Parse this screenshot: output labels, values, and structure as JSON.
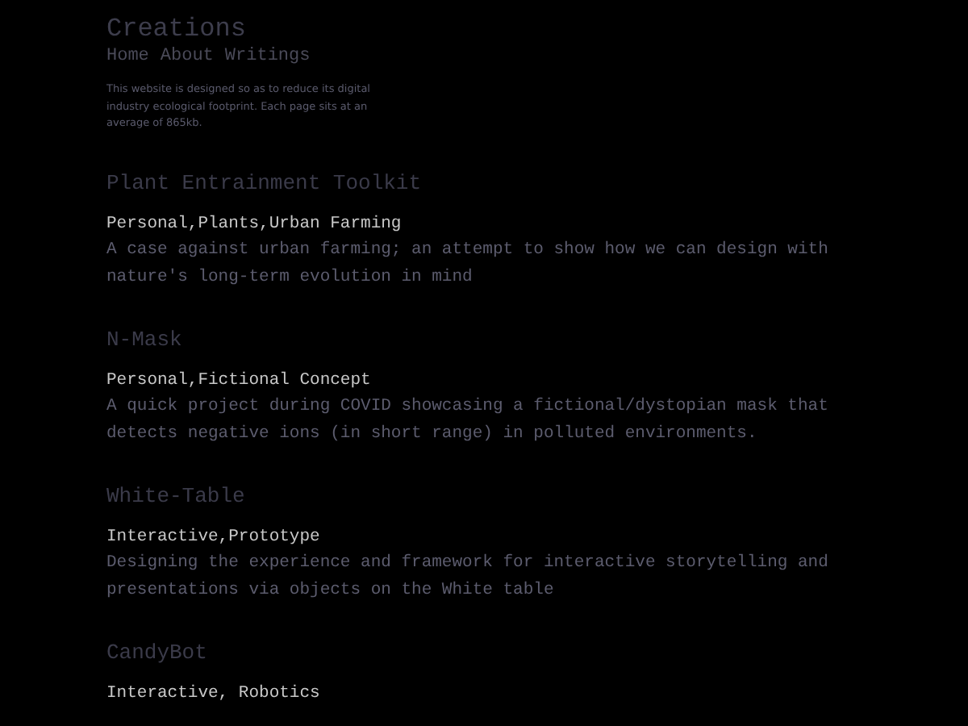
{
  "site_title": "Creations",
  "nav": [
    {
      "label": "Home"
    },
    {
      "label": "About"
    },
    {
      "label": "Writings"
    }
  ],
  "blurb": "This website is designed so as to reduce its digital industry ecological footprint. Each page sits at an average of 865kb.",
  "projects": [
    {
      "title": "Plant Entrainment Toolkit",
      "tags": "Personal,Plants,Urban Farming",
      "description": "A case against urban farming; an attempt to show how we can design with nature's long-term evolution in mind"
    },
    {
      "title": "N-Mask",
      "tags": "Personal,Fictional Concept",
      "description": "A quick project during COVID showcasing a fictional/dystopian mask that detects negative ions (in short range) in polluted environments."
    },
    {
      "title": "White-Table",
      "tags": "Interactive,Prototype",
      "description": "Designing the experience and framework for interactive storytelling and presentations via objects on the White table"
    },
    {
      "title": "CandyBot",
      "tags": "Interactive, Robotics"
    }
  ]
}
